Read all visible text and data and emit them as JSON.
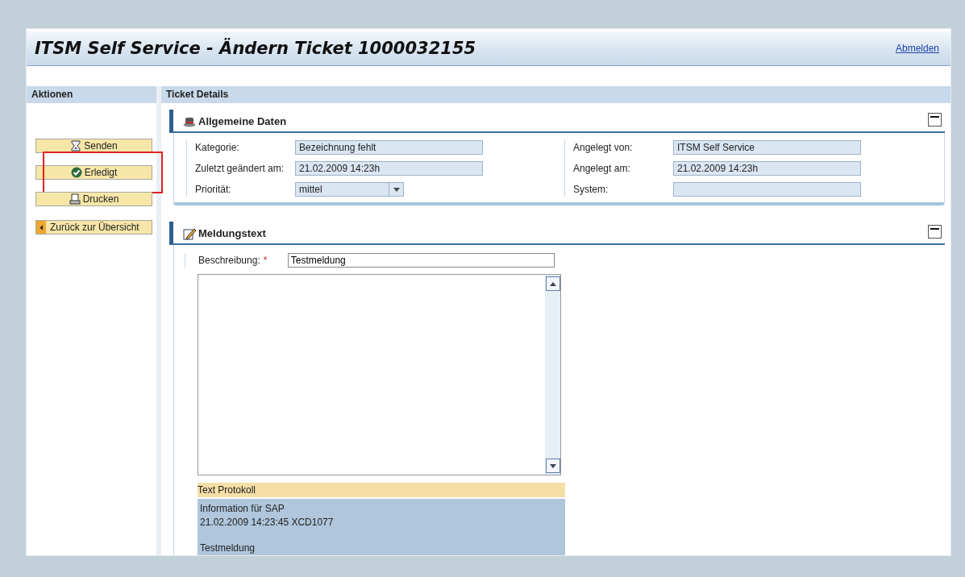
{
  "page": {
    "title": "ITSM Self Service - Ändern Ticket 1000032155",
    "logout_link": "Abmelden"
  },
  "actions_panel": {
    "title": "Aktionen",
    "buttons": [
      {
        "label": "Senden",
        "kind": "send",
        "highlighted": false
      },
      {
        "label": "Erledigt",
        "kind": "done",
        "highlighted": true
      },
      {
        "label": "Drucken",
        "kind": "print",
        "highlighted": false
      }
    ],
    "back_button": "Zurück zur Übersicht"
  },
  "details": {
    "title": "Ticket Details",
    "general": {
      "title": "Allgemeine Daten",
      "left_fields": [
        {
          "label": "Kategorie:",
          "value": "Bezeichnung fehlt",
          "kind": "text"
        },
        {
          "label": "Zuletzt geändert am:",
          "value": "21.02.2009 14:23h",
          "kind": "text"
        },
        {
          "label": "Priorität:",
          "value": "mittel",
          "kind": "dropdown"
        }
      ],
      "right_fields": [
        {
          "label": "Angelegt von:",
          "value": "ITSM Self Service",
          "kind": "text"
        },
        {
          "label": "Angelegt am:",
          "value": "21.02.2009 14:23h",
          "kind": "text"
        },
        {
          "label": "System:",
          "kind": "text"
        }
      ]
    },
    "message": {
      "title": "Meldungstext",
      "description_label": "Beschreibung:",
      "required_marker": "*",
      "description_value": "Testmeldung",
      "log": {
        "title": "Text Protokoll",
        "entries": [
          {
            "lines": [
              "Information für SAP",
              "21.02.2009 14:23:45 XCD1077"
            ]
          },
          {
            "lines": [
              "Testmeldung"
            ]
          }
        ]
      }
    }
  }
}
